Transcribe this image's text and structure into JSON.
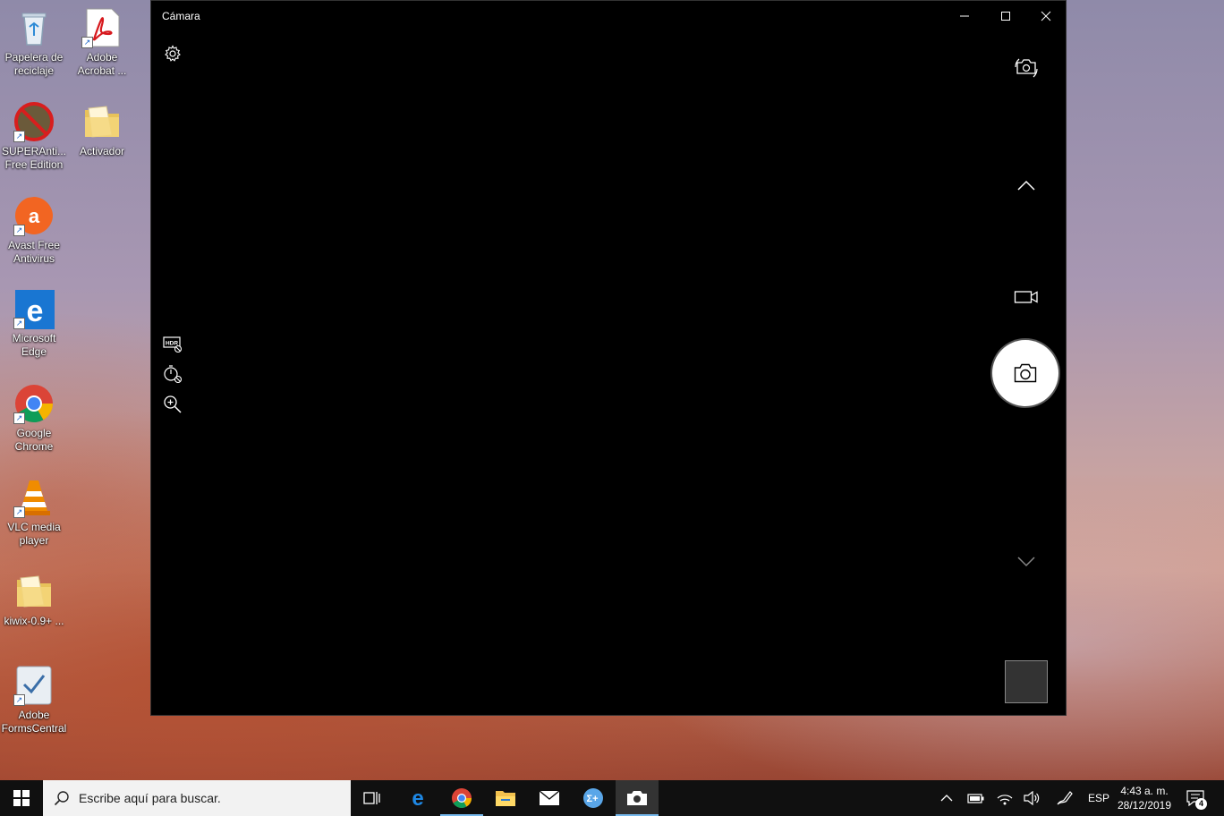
{
  "desktop": {
    "icons": [
      {
        "label": "Papelera de reciclaje",
        "icon": "recycle-bin-icon"
      },
      {
        "label": "Adobe Acrobat ...",
        "icon": "adobe-acrobat-icon"
      },
      {
        "label": "SUPERAnti... Free Edition",
        "icon": "superantispyware-icon"
      },
      {
        "label": "Activador",
        "icon": "folder-icon"
      },
      {
        "label": "Avast Free Antivirus",
        "icon": "avast-icon"
      },
      {
        "label": "Microsoft Edge",
        "icon": "edge-icon"
      },
      {
        "label": "Google Chrome",
        "icon": "chrome-icon"
      },
      {
        "label": "VLC media player",
        "icon": "vlc-icon"
      },
      {
        "label": "kiwix-0.9+ ...",
        "icon": "folder-icon"
      },
      {
        "label": "Adobe FormsCentral",
        "icon": "forms-central-icon"
      }
    ]
  },
  "window": {
    "title": "Cámara",
    "controls": [
      "minimize-icon",
      "maximize-icon",
      "close-icon"
    ]
  },
  "camera": {
    "left_tools": [
      "settings-icon",
      "hdr-off-icon",
      "timer-off-icon",
      "zoom-icon"
    ],
    "right_tools": [
      "switch-camera-icon",
      "chevron-up-icon",
      "video-mode-icon",
      "photo-capture-icon",
      "chevron-down-icon",
      "last-capture-thumbnail"
    ]
  },
  "taskbar": {
    "search_placeholder": "Escribe aquí para buscar.",
    "apps": [
      "task-view-icon",
      "edge-icon",
      "chrome-icon",
      "file-explorer-icon",
      "mail-icon",
      "calculator-app-icon",
      "camera-app-icon"
    ],
    "language": "ESP",
    "time": "4:43 a. m.",
    "date": "28/12/2019",
    "notification_count": "4",
    "colors": {
      "accent": "#76b9ed",
      "bar": "#101010"
    }
  }
}
